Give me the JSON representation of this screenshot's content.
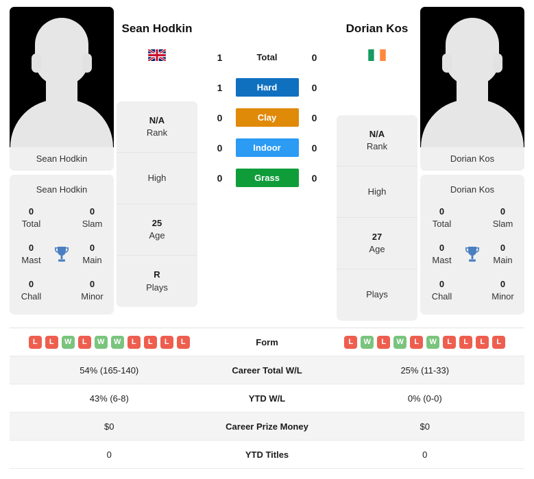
{
  "colors": {
    "hard": "#1070c0",
    "clay": "#e08a0a",
    "indoor": "#2b9bf4",
    "grass": "#0f9d3a",
    "win": "#7ac47e",
    "loss": "#ee5e4f",
    "trophy": "#4a7fc1"
  },
  "players": {
    "left": {
      "name": "Sean Hodkin",
      "photo_caption": "Sean Hodkin",
      "flag": "gb-flag-icon",
      "flag_title": "Great Britain",
      "awards_title": "Sean Hodkin",
      "awards": [
        {
          "num": "0",
          "label": "Total"
        },
        {
          "num": "0",
          "label": "Slam"
        },
        {
          "num": "0",
          "label": "Mast"
        },
        {
          "num": "0",
          "label": "Main"
        },
        {
          "num": "0",
          "label": "Chall"
        },
        {
          "num": "0",
          "label": "Minor"
        }
      ],
      "info": [
        {
          "value": "N/A",
          "label": "Rank"
        },
        {
          "value": "",
          "label": "High"
        },
        {
          "value": "25",
          "label": "Age"
        },
        {
          "value": "R",
          "label": "Plays"
        }
      ],
      "form": [
        "L",
        "L",
        "W",
        "L",
        "W",
        "W",
        "L",
        "L",
        "L",
        "L"
      ]
    },
    "right": {
      "name": "Dorian Kos",
      "photo_caption": "Dorian Kos",
      "flag": "ie-flag-icon",
      "flag_title": "Ireland",
      "awards_title": "Dorian Kos",
      "awards": [
        {
          "num": "0",
          "label": "Total"
        },
        {
          "num": "0",
          "label": "Slam"
        },
        {
          "num": "0",
          "label": "Mast"
        },
        {
          "num": "0",
          "label": "Main"
        },
        {
          "num": "0",
          "label": "Chall"
        },
        {
          "num": "0",
          "label": "Minor"
        }
      ],
      "info": [
        {
          "value": "N/A",
          "label": "Rank"
        },
        {
          "value": "",
          "label": "High"
        },
        {
          "value": "27",
          "label": "Age"
        },
        {
          "value": "",
          "label": "Plays"
        }
      ],
      "form": [
        "L",
        "W",
        "L",
        "W",
        "L",
        "W",
        "L",
        "L",
        "L",
        "L"
      ]
    }
  },
  "h2h": [
    {
      "label": "Total",
      "left": "1",
      "right": "0",
      "style": "plain"
    },
    {
      "label": "Hard",
      "left": "1",
      "right": "0",
      "style": "hard"
    },
    {
      "label": "Clay",
      "left": "0",
      "right": "0",
      "style": "clay"
    },
    {
      "label": "Indoor",
      "left": "0",
      "right": "0",
      "style": "indoor"
    },
    {
      "label": "Grass",
      "left": "0",
      "right": "0",
      "style": "grass"
    }
  ],
  "stats": {
    "form_label": "Form",
    "rows": [
      {
        "label": "Career Total W/L",
        "left": "54% (165-140)",
        "right": "25% (11-33)"
      },
      {
        "label": "YTD W/L",
        "left": "43% (6-8)",
        "right": "0% (0-0)"
      },
      {
        "label": "Career Prize Money",
        "left": "$0",
        "right": "$0"
      },
      {
        "label": "YTD Titles",
        "left": "0",
        "right": "0"
      }
    ]
  }
}
